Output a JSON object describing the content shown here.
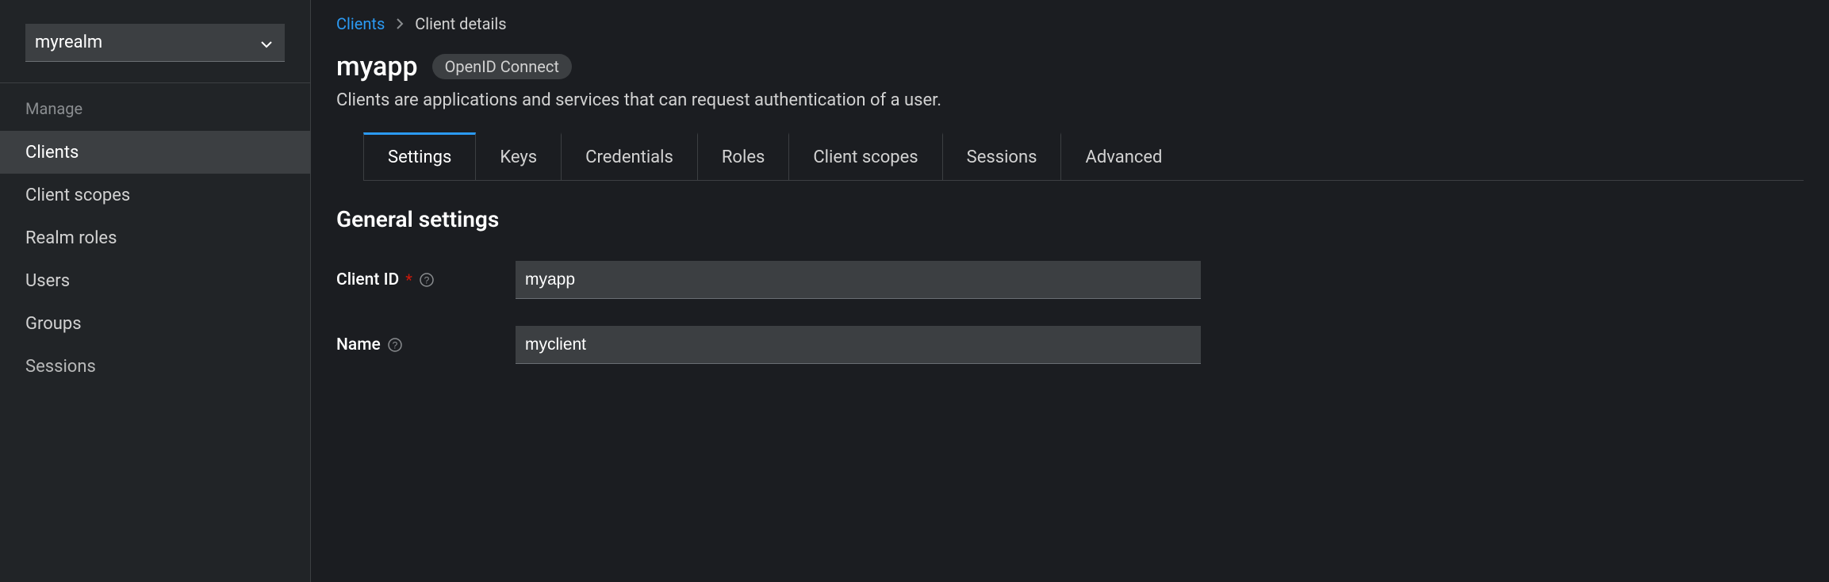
{
  "sidebar": {
    "realm_selector": "myrealm",
    "section_heading": "Manage",
    "items": [
      {
        "label": "Clients",
        "active": true
      },
      {
        "label": "Client scopes",
        "active": false
      },
      {
        "label": "Realm roles",
        "active": false
      },
      {
        "label": "Users",
        "active": false
      },
      {
        "label": "Groups",
        "active": false
      },
      {
        "label": "Sessions",
        "active": false
      }
    ]
  },
  "breadcrumbs": {
    "link": "Clients",
    "current": "Client details"
  },
  "header": {
    "title": "myapp",
    "protocol_badge": "OpenID Connect",
    "description": "Clients are applications and services that can request authentication of a user."
  },
  "tabs": [
    {
      "label": "Settings",
      "active": true
    },
    {
      "label": "Keys",
      "active": false
    },
    {
      "label": "Credentials",
      "active": false
    },
    {
      "label": "Roles",
      "active": false
    },
    {
      "label": "Client scopes",
      "active": false
    },
    {
      "label": "Sessions",
      "active": false
    },
    {
      "label": "Advanced",
      "active": false
    }
  ],
  "settings": {
    "section_title": "General settings",
    "fields": {
      "client_id": {
        "label": "Client ID",
        "required": "*",
        "value": "myapp"
      },
      "name": {
        "label": "Name",
        "value": "myclient"
      }
    }
  }
}
